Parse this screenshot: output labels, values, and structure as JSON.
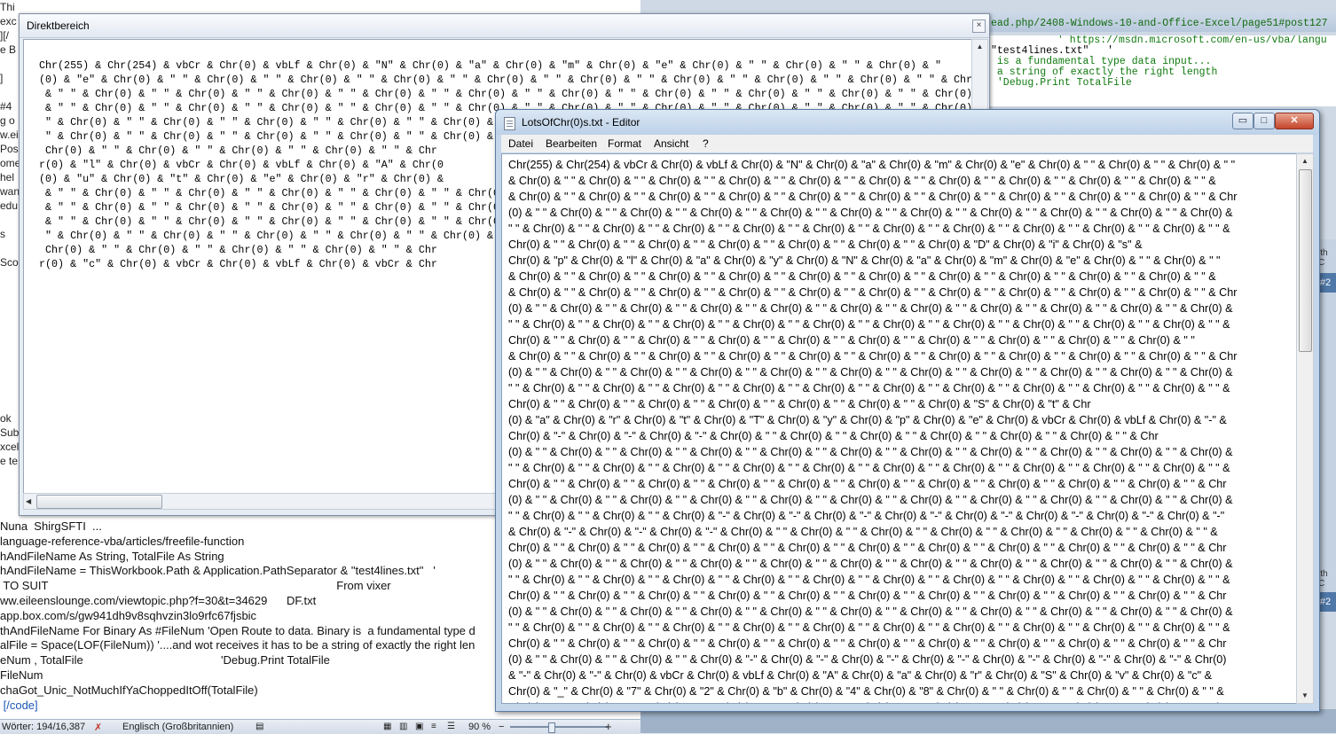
{
  "word_doc": {
    "left_fragments": [
      "Thi",
      "exc",
      "][/",
      "e B",
      "",
      "]",
      "",
      "#4",
      "g o",
      "w.ei",
      "Pos",
      "ome",
      "hel",
      "wan",
      "edu",
      "",
      "s",
      "",
      "Sco",
      "",
      "",
      "",
      "",
      "",
      "",
      "",
      "",
      "",
      "",
      "ok",
      "Sub",
      "xcel",
      "e te"
    ],
    "lines": [
      "Nuna  ShirgSFTI  ...",
      "language-reference-vba/articles/freefile-function",
      "hAndFileName As String, TotalFile As String",
      "hAndFileName = ThisWorkbook.Path & Application.PathSeparator & \"test4lines.txt\"   '",
      " TO SUIT                                                                                          From vixer",
      "ww.eileenslounge.com/viewtopic.php?f=30&t=34629      DF.txt",
      "app.box.com/s/gw941dh9v8sqhvzin3lo9rfc67fjsbic",
      "thAndFileName For Binary As #FileNum 'Open Route to data. Binary is  a fundamental type d",
      "alFile = Space(LOF(FileNum)) '....and wot receives it has to be a string of exactly the right len",
      "eNum , TotalFile                                           'Debug.Print TotalFile",
      "FileNum",
      "chaGot_Unic_NotMuchIfYaChoppedItOff(TotalFile)",
      " [/code]"
    ]
  },
  "status_bar": {
    "word_count": "Wörter: 194/16,387",
    "language": "Englisch (Großbritannien)",
    "zoom": "90 %",
    "zoom_plus": "+"
  },
  "vba_editor": {
    "url_line": "ead.php/2408-Windows-10-and-Office-Excel/page51#post127",
    "lines": [
      "' https://msdn.microsoft.com/en-us/vba/langu",
      "\"test4lines.txt\"   '",
      " is a fundamental type data input...",
      " a string of exactly the right length",
      " 'Debug.Print TotalFile"
    ],
    "right_tags": [
      "#2",
      "#2"
    ],
    "right_labels": [
      "ith C",
      "ith C"
    ]
  },
  "immediate_window": {
    "title": "Direktbereich",
    "close_label": "×",
    "content": "Chr(255) & Chr(254) & vbCr & Chr(0) & vbLf & Chr(0) & \"N\" & Chr(0) & \"a\" & Chr(0) & \"m\" & Chr(0) & \"e\" & Chr(0) & \" \" & Chr(0) & \" \" & Chr(0) & \"\n(0) & \"e\" & Chr(0) & \" \" & Chr(0) & \" \" & Chr(0) & \" \" & Chr(0) & \" \" & Chr(0) & \" \" & Chr(0) & \" \" & Chr(0) & \" \" & Chr(0) & \" \" & Chr(0) & \" \" & Chr(0) & \" \" & Chr(0) & \" \" & Chr\n & \" \" & Chr(0) & \" \" & Chr(0) & \" \" & Chr(0) & \" \" & Chr(0) & \" \" & Chr(0) & \" \" & Chr(0) & \" \" & Chr(0) & \" \" & Chr(0) & \" \" & Chr(0) & \" \" & Chr(0) & \" \" & Chr\n & \" \" & Chr(0) & \" \" & Chr(0) & \" \" & Chr(0) & \" \" & Chr(0) & \" \" & Chr(0) & \" \" & Chr(0) & \" \" & Chr(0) & \" \" & Chr(0) & \" \" & Chr(0) & \" \" & Chr(0) & \" \" & Chr\n \" & Chr(0) & \" \" & Chr(0) & \" \" & Chr(0) & \" \" & Chr(0) & \" \" & Chr(0) & \" \" & Chr(0) & \" \" & Chr(0) & \" \" & Chr(0) & \" \" & Chr(0) & \" \" & Chr(0) & \" \" & Chr(0) & \" \" & Chr\n \" & Chr(0) & \" \" & Chr(0) & \" \" & Chr(0) & \" \" & Chr(0) & \" \" & Chr(0) & \" \" & Chr\n Chr(0) & \" \" & Chr(0) & \" \" & Chr(0) & \" \" & Chr(0) & \" \" & Chr\nr(0) & \"l\" & Chr(0) & vbCr & Chr(0) & vbLf & Chr(0) & \"A\" & Chr(0\n(0) & \"u\" & Chr(0) & \"t\" & Chr(0) & \"e\" & Chr(0) & \"r\" & Chr(0) &\n & \" \" & Chr(0) & \" \" & Chr(0) & \" \" & Chr(0) & \" \" & Chr(0) & \" \" & Chr(0) &\n & \" \" & Chr(0) & \" \" & Chr(0) & \" \" & Chr(0) & \" \" & Chr(0) & \" \" & Chr(0) &\n & \" \" & Chr(0) & \" \" & Chr(0) & \" \" & Chr(0) & \" \" & Chr(0) & \" \" & Chr(0) &\n \" & Chr(0) & \" \" & Chr(0) & \" \" & Chr(0) & \" \" & Chr(0) & \" \" & Chr(0) & \" \" & C\n Chr(0) & \" \" & Chr(0) & \" \" & Chr(0) & \" \" & Chr(0) & \" \" & Chr\nr(0) & \"c\" & Chr(0) & vbCr & Chr(0) & vbLf & Chr(0) & vbCr & Chr"
  },
  "editor": {
    "title": "LotsOfChr(0)s.txt - Editor",
    "minimize_label": "▭",
    "maximize_label": "□",
    "close_label": "✕",
    "menu": [
      "Datei",
      "Bearbeiten",
      "Format",
      "Ansicht",
      "?"
    ],
    "content": "Chr(255) & Chr(254) & vbCr & Chr(0) & vbLf & Chr(0) & \"N\" & Chr(0) & \"a\" & Chr(0) & \"m\" & Chr(0) & \"e\" & Chr(0) & \" \" & Chr(0) & \" \" & Chr(0) & \" \"\n& Chr(0) & \" \" & Chr(0) & \" \" & Chr(0) & \" \" & Chr(0) & \" \" & Chr(0) & \" \" & Chr(0) & \" \" & Chr(0) & \" \" & Chr(0) & \" \" & Chr(0) & \" \" & Chr(0) & \" \" &\n& Chr(0) & \" \" & Chr(0) & \" \" & Chr(0) & \" \" & Chr(0) & \" \" & Chr(0) & \" \" & Chr(0) & \" \" & Chr(0) & \" \" & Chr(0) & \" \" & Chr(0) & \" \" & Chr(0) & \" \" & Chr\n(0) & \" \" & Chr(0) & \" \" & Chr(0) & \" \" & Chr(0) & \" \" & Chr(0) & \" \" & Chr(0) & \" \" & Chr(0) & \" \" & Chr(0) & \" \" & Chr(0) & \" \" & Chr(0) & \" \" & Chr(0) &\n\" \" & Chr(0) & \" \" & Chr(0) & \" \" & Chr(0) & \" \" & Chr(0) & \" \" & Chr(0) & \" \" & Chr(0) & \" \" & Chr(0) & \" \" & Chr(0) & \" \" & Chr(0) & \" \" & Chr(0) & \" \" &\nChr(0) & \" \" & Chr(0) & \" \" & Chr(0) & \" \" & Chr(0) & \" \" & Chr(0) & \" \" & Chr(0) & \" \" & Chr(0) & \"D\" & Chr(0) & \"i\" & Chr(0) & \"s\" &\nChr(0) & \"p\" & Chr(0) & \"l\" & Chr(0) & \"a\" & Chr(0) & \"y\" & Chr(0) & \"N\" & Chr(0) & \"a\" & Chr(0) & \"m\" & Chr(0) & \"e\" & Chr(0) & \" \" & Chr(0) & \" \"\n& Chr(0) & \" \" & Chr(0) & \" \" & Chr(0) & \" \" & Chr(0) & \" \" & Chr(0) & \" \" & Chr(0) & \" \" & Chr(0) & \" \" & Chr(0) & \" \" & Chr(0) & \" \" & Chr(0) & \" \" &\n& Chr(0) & \" \" & Chr(0) & \" \" & Chr(0) & \" \" & Chr(0) & \" \" & Chr(0) & \" \" & Chr(0) & \" \" & Chr(0) & \" \" & Chr(0) & \" \" & Chr(0) & \" \" & Chr(0) & \" \" & Chr\n(0) & \" \" & Chr(0) & \" \" & Chr(0) & \" \" & Chr(0) & \" \" & Chr(0) & \" \" & Chr(0) & \" \" & Chr(0) & \" \" & Chr(0) & \" \" & Chr(0) & \" \" & Chr(0) & \" \" & Chr(0) &\n\" \" & Chr(0) & \" \" & Chr(0) & \" \" & Chr(0) & \" \" & Chr(0) & \" \" & Chr(0) & \" \" & Chr(0) & \" \" & Chr(0) & \" \" & Chr(0) & \" \" & Chr(0) & \" \" & Chr(0) & \" \" &\nChr(0) & \" \" & Chr(0) & \" \" & Chr(0) & \" \" & Chr(0) & \" \" & Chr(0) & \" \" & Chr(0) & \" \" & Chr(0) & \" \" & Chr(0) & \" \" & Chr(0) & \" \" & Chr(0) & \" \"\n& Chr(0) & \" \" & Chr(0) & \" \" & Chr(0) & \" \" & Chr(0) & \" \" & Chr(0) & \" \" & Chr(0) & \" \" & Chr(0) & \" \" & Chr(0) & \" \" & Chr(0) & \" \" & Chr(0) & \" \" & Chr\n(0) & \" \" & Chr(0) & \" \" & Chr(0) & \" \" & Chr(0) & \" \" & Chr(0) & \" \" & Chr(0) & \" \" & Chr(0) & \" \" & Chr(0) & \" \" & Chr(0) & \" \" & Chr(0) & \" \" & Chr(0) &\n\" \" & Chr(0) & \" \" & Chr(0) & \" \" & Chr(0) & \" \" & Chr(0) & \" \" & Chr(0) & \" \" & Chr(0) & \" \" & Chr(0) & \" \" & Chr(0) & \" \" & Chr(0) & \" \" & Chr(0) & \" \" &\nChr(0) & \" \" & Chr(0) & \" \" & Chr(0) & \" \" & Chr(0) & \" \" & Chr(0) & \" \" & Chr(0) & \" \" & Chr(0) & \"S\" & Chr(0) & \"t\" & Chr\n(0) & \"a\" & Chr(0) & \"r\" & Chr(0) & \"t\" & Chr(0) & \"T\" & Chr(0) & \"y\" & Chr(0) & \"p\" & Chr(0) & \"e\" & Chr(0) & vbCr & Chr(0) & vbLf & Chr(0) & \"-\" &\nChr(0) & \"-\" & Chr(0) & \"-\" & Chr(0) & \"-\" & Chr(0) & \" \" & Chr(0) & \" \" & Chr(0) & \" \" & Chr(0) & \" \" & Chr(0) & \" \" & Chr(0) & \" \" & Chr\n(0) & \" \" & Chr(0) & \" \" & Chr(0) & \" \" & Chr(0) & \" \" & Chr(0) & \" \" & Chr(0) & \" \" & Chr(0) & \" \" & Chr(0) & \" \" & Chr(0) & \" \" & Chr(0) & \" \" & Chr(0) &\n\" \" & Chr(0) & \" \" & Chr(0) & \" \" & Chr(0) & \" \" & Chr(0) & \" \" & Chr(0) & \" \" & Chr(0) & \" \" & Chr(0) & \" \" & Chr(0) & \" \" & Chr(0) & \" \" & Chr(0) & \" \" &\nChr(0) & \" \" & Chr(0) & \" \" & Chr(0) & \" \" & Chr(0) & \" \" & Chr(0) & \" \" & Chr(0) & \" \" & Chr(0) & \" \" & Chr(0) & \" \" & Chr(0) & \" \" & Chr(0) & \" \" & Chr\n(0) & \" \" & Chr(0) & \" \" & Chr(0) & \" \" & Chr(0) & \" \" & Chr(0) & \" \" & Chr(0) & \" \" & Chr(0) & \" \" & Chr(0) & \" \" & Chr(0) & \" \" & Chr(0) & \" \" & Chr(0) &\n\" \" & Chr(0) & \" \" & Chr(0) & \" \" & Chr(0) & \"-\" & Chr(0) & \"-\" & Chr(0) & \"-\" & Chr(0) & \"-\" & Chr(0) & \"-\" & Chr(0) & \"-\" & Chr(0) & \"-\" & Chr(0) & \"-\"\n& Chr(0) & \"-\" & Chr(0) & \"-\" & Chr(0) & \"-\" & Chr(0) & \" \" & Chr(0) & \" \" & Chr(0) & \" \" & Chr(0) & \" \" & Chr(0) & \" \" & Chr(0) & \" \" & Chr(0) & \" \" &\nChr(0) & \" \" & Chr(0) & \" \" & Chr(0) & \" \" & Chr(0) & \" \" & Chr(0) & \" \" & Chr(0) & \" \" & Chr(0) & \" \" & Chr(0) & \" \" & Chr(0) & \" \" & Chr(0) & \" \" & Chr\n(0) & \" \" & Chr(0) & \" \" & Chr(0) & \" \" & Chr(0) & \" \" & Chr(0) & \" \" & Chr(0) & \" \" & Chr(0) & \" \" & Chr(0) & \" \" & Chr(0) & \" \" & Chr(0) & \" \" & Chr(0) &\n\" \" & Chr(0) & \" \" & Chr(0) & \" \" & Chr(0) & \" \" & Chr(0) & \" \" & Chr(0) & \" \" & Chr(0) & \" \" & Chr(0) & \" \" & Chr(0) & \" \" & Chr(0) & \" \" & Chr(0) & \" \" &\nChr(0) & \" \" & Chr(0) & \" \" & Chr(0) & \" \" & Chr(0) & \" \" & Chr(0) & \" \" & Chr(0) & \" \" & Chr(0) & \" \" & Chr(0) & \" \" & Chr(0) & \" \" & Chr(0) & \" \" & Chr\n(0) & \" \" & Chr(0) & \" \" & Chr(0) & \" \" & Chr(0) & \" \" & Chr(0) & \" \" & Chr(0) & \" \" & Chr(0) & \" \" & Chr(0) & \" \" & Chr(0) & \" \" & Chr(0) & \" \" & Chr(0) &\n\" \" & Chr(0) & \" \" & Chr(0) & \" \" & Chr(0) & \" \" & Chr(0) & \" \" & Chr(0) & \" \" & Chr(0) & \" \" & Chr(0) & \" \" & Chr(0) & \" \" & Chr(0) & \" \" & Chr(0) & \" \" &\nChr(0) & \" \" & Chr(0) & \" \" & Chr(0) & \" \" & Chr(0) & \" \" & Chr(0) & \" \" & Chr(0) & \" \" & Chr(0) & \" \" & Chr(0) & \" \" & Chr(0) & \" \" & Chr(0) & \" \" & Chr\n(0) & \" \" & Chr(0) & \" \" & Chr(0) & \" \" & Chr(0) & \"-\" & Chr(0) & \"-\" & Chr(0) & \"-\" & Chr(0) & \"-\" & Chr(0) & \"-\" & Chr(0) & \"-\" & Chr(0) & \"-\" & Chr(0)\n& \"-\" & Chr(0) & \"-\" & Chr(0) & vbCr & Chr(0) & vbLf & Chr(0) & \"A\" & Chr(0) & \"a\" & Chr(0) & \"r\" & Chr(0) & \"S\" & Chr(0) & \"v\" & Chr(0) & \"c\" &\nChr(0) & \"_\" & Chr(0) & \"7\" & Chr(0) & \"2\" & Chr(0) & \"b\" & Chr(0) & \"4\" & Chr(0) & \"8\" & Chr(0) & \" \" & Chr(0) & \" \" & Chr(0) & \" \" & Chr(0) & \" \" &\nChr(0) & \" \" & Chr(0) & \" \" & Chr(0) & \" \" & Chr(0) & \" \" & Chr(0) & \" \" & Chr(0) & \" \" & Chr(0) & \" \" & Chr(0) & \" \" & Chr(0) & \" \" & Chr(0) & \" \" & Chr"
  }
}
